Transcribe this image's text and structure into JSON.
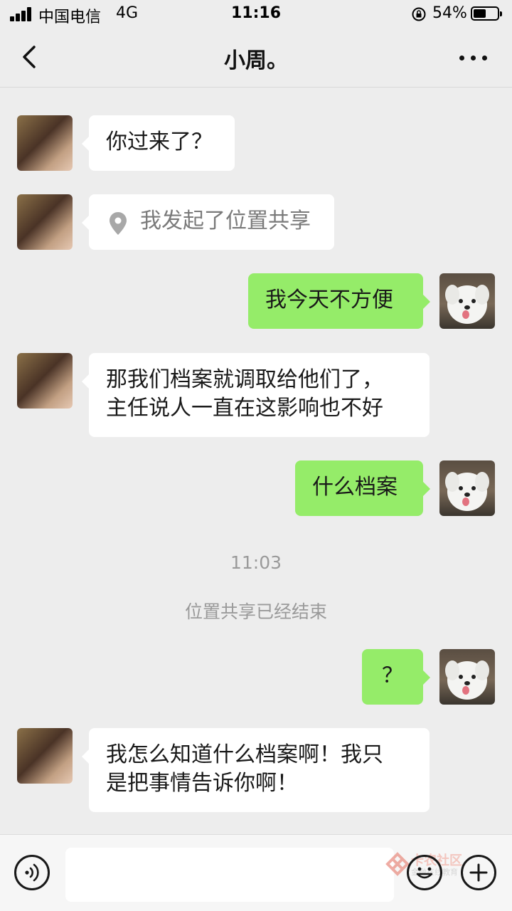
{
  "status_bar": {
    "carrier": "中国电信",
    "network": "4G",
    "time": "11:16",
    "battery_percent": "54%",
    "battery_level": 0.54
  },
  "nav": {
    "title": "小周。"
  },
  "messages": [
    {
      "side": "left",
      "text": "你过来了？"
    },
    {
      "side": "left",
      "type": "location",
      "text": "我发起了位置共享"
    },
    {
      "side": "right",
      "text": "我今天不方便"
    },
    {
      "side": "left",
      "lines": [
        "那我们档案就调取给他们了，",
        "主任说人一直在这影响也不好"
      ]
    },
    {
      "side": "right",
      "text": "什么档案"
    },
    {
      "side": "right",
      "text": "？"
    },
    {
      "side": "left",
      "lines": [
        "我怎么知道什么档案啊！我只",
        "是把事情告诉你啊！"
      ]
    }
  ],
  "system": {
    "timestamp": "11:03",
    "notice": "位置共享已经结束"
  },
  "watermark": {
    "text": "卡农社区",
    "sub": "金融在线教育"
  },
  "colors": {
    "background": "#ededed",
    "bubble_self": "#95ec69",
    "bubble_other": "#ffffff"
  }
}
